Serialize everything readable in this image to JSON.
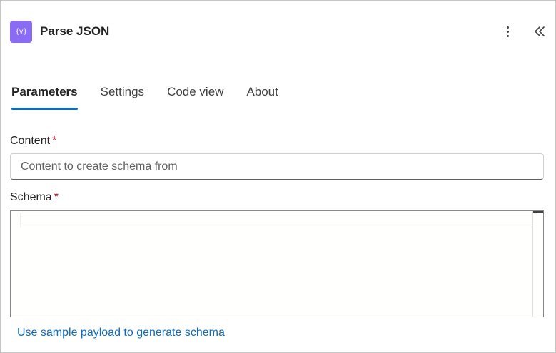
{
  "header": {
    "icon": "curly-braces-variable-icon",
    "icon_text": "{v}",
    "title": "Parse JSON",
    "more_icon": "more-vertical-icon",
    "collapse_icon": "double-chevron-left-icon",
    "accent_color": "#8a6cf4"
  },
  "tabs": [
    {
      "label": "Parameters",
      "active": true
    },
    {
      "label": "Settings",
      "active": false
    },
    {
      "label": "Code view",
      "active": false
    },
    {
      "label": "About",
      "active": false
    }
  ],
  "fields": {
    "content": {
      "label": "Content",
      "required_marker": "*",
      "placeholder": "Content to create schema from",
      "value": ""
    },
    "schema": {
      "label": "Schema",
      "required_marker": "*",
      "value": ""
    }
  },
  "links": {
    "sample_payload": "Use sample payload to generate schema"
  },
  "colors": {
    "link": "#0f6cbd",
    "active_tab_underline": "#0f6cbd",
    "required": "#c50f1f"
  }
}
